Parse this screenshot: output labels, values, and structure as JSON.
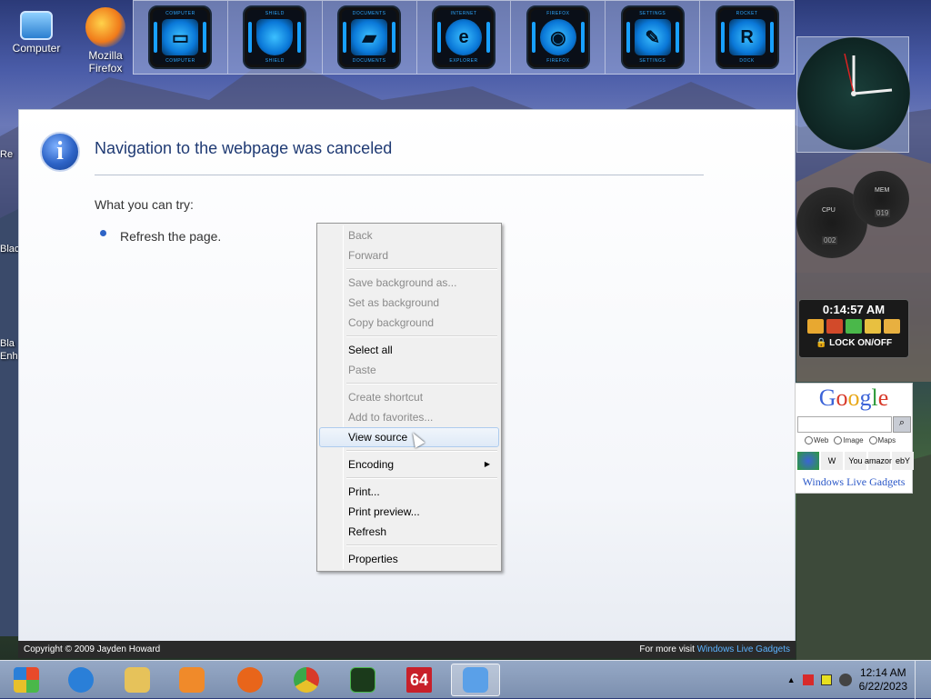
{
  "desktop": {
    "icons": [
      {
        "label": "Computer",
        "icon": "monitor-icon"
      },
      {
        "label": "Mozilla Firefox",
        "icon": "firefox-icon"
      }
    ],
    "edge_labels": [
      "Re",
      "Blac",
      "Bla",
      "Enh"
    ]
  },
  "launcher": {
    "tiles": [
      {
        "top": "COMPUTER",
        "bottom": "COMPUTER",
        "icon": "monitor-icon"
      },
      {
        "top": "SHIELD",
        "bottom": "SHIELD",
        "icon": "shield-icon"
      },
      {
        "top": "DOCUMENTS",
        "bottom": "DOCUMENTS",
        "icon": "folder-icon"
      },
      {
        "top": "INTERNET",
        "bottom": "EXPLORER",
        "icon": "internet-explorer-icon"
      },
      {
        "top": "FIREFOX",
        "bottom": "FIREFOX",
        "icon": "firefox-icon"
      },
      {
        "top": "SETTINGS",
        "bottom": "SETTINGS",
        "icon": "wrench-icon"
      },
      {
        "top": "ROCKET",
        "bottom": "DOCK",
        "icon": "rocket-dock-icon"
      }
    ]
  },
  "panel": {
    "heading": "Navigation to the webpage was canceled",
    "try_label": "What you can try:",
    "refresh_text": "Refresh the page."
  },
  "footer": {
    "copyright": "Copyright © 2009 Jayden Howard",
    "visit_prefix": "For more visit",
    "visit_link": "Windows Live Gadgets"
  },
  "context_menu": {
    "groups": [
      [
        {
          "label": "Back",
          "disabled": true
        },
        {
          "label": "Forward",
          "disabled": true
        }
      ],
      [
        {
          "label": "Save background as...",
          "disabled": true
        },
        {
          "label": "Set as background",
          "disabled": true
        },
        {
          "label": "Copy background",
          "disabled": true
        }
      ],
      [
        {
          "label": "Select all",
          "disabled": false
        },
        {
          "label": "Paste",
          "disabled": true
        }
      ],
      [
        {
          "label": "Create shortcut",
          "disabled": true
        },
        {
          "label": "Add to favorites...",
          "disabled": true
        },
        {
          "label": "View source",
          "disabled": false,
          "hover": true
        }
      ],
      [
        {
          "label": "Encoding",
          "disabled": false,
          "submenu": true
        }
      ],
      [
        {
          "label": "Print...",
          "disabled": false
        },
        {
          "label": "Print preview...",
          "disabled": false
        },
        {
          "label": "Refresh",
          "disabled": false
        }
      ],
      [
        {
          "label": "Properties",
          "disabled": false
        }
      ]
    ]
  },
  "gadgets": {
    "lock": {
      "time": "0:14:57 AM",
      "label": "LOCK ON/OFF"
    },
    "meters": {
      "cpu": "CPU",
      "mem": "MEM",
      "cpu_value": "002",
      "mem_value": "019"
    },
    "google": {
      "logo": [
        "G",
        "o",
        "o",
        "g",
        "l",
        "e"
      ],
      "options": [
        "Web",
        "Image",
        "Maps"
      ],
      "tools": [
        "W",
        "You",
        "amazon",
        "ebY"
      ],
      "footer": "Windows Live Gadgets"
    }
  },
  "taskbar": {
    "apps": [
      {
        "icon": "internet-explorer-icon",
        "color": "#2a7fd8"
      },
      {
        "icon": "file-explorer-icon",
        "color": "#e6c25a"
      },
      {
        "icon": "media-player-icon",
        "color": "#f08a2a"
      },
      {
        "icon": "firefox-icon",
        "color": "#e8651a"
      },
      {
        "icon": "chrome-icon",
        "color": "#3aa84a"
      },
      {
        "icon": "system-monitor-icon",
        "color": "#1b3a1b"
      },
      {
        "icon": "c64-icon",
        "color": "#c8202a",
        "text": "64"
      },
      {
        "icon": "gadget-window-icon",
        "color": "#5aa0e8",
        "active": true
      }
    ],
    "time": "12:14 AM",
    "date": "6/22/2023"
  }
}
